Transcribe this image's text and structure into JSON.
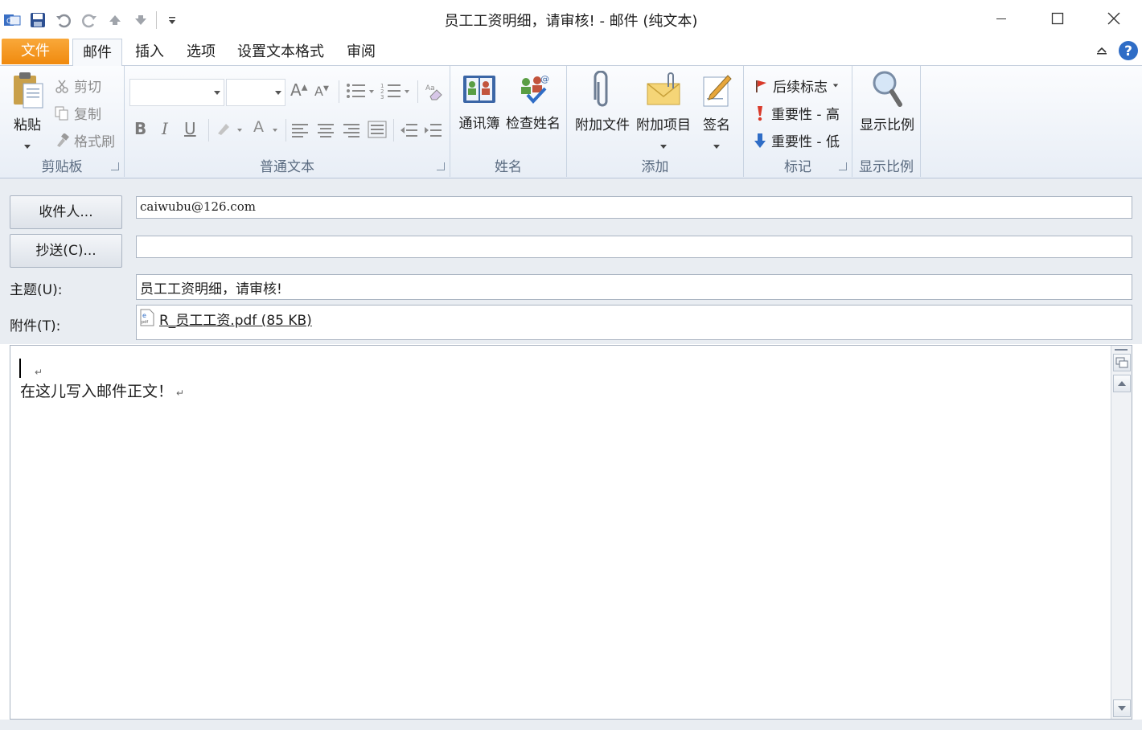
{
  "window": {
    "title": "员工工资明细，请审核!  - 邮件 (纯文本)"
  },
  "tabs": [
    {
      "label": "文件"
    },
    {
      "label": "邮件"
    },
    {
      "label": "插入"
    },
    {
      "label": "选项"
    },
    {
      "label": "设置文本格式"
    },
    {
      "label": "审阅"
    }
  ],
  "ribbon": {
    "clipboard": {
      "label": "剪贴板",
      "paste": "粘贴",
      "cut": "剪切",
      "copy": "复制",
      "format_painter": "格式刷"
    },
    "basic_text": {
      "label": "普通文本"
    },
    "names": {
      "label": "姓名",
      "address_book": "通讯簿",
      "check_names": "检查姓名"
    },
    "include": {
      "label": "添加",
      "attach_file": "附加文件",
      "attach_item": "附加项目",
      "signature": "签名"
    },
    "tags": {
      "label": "标记",
      "follow_up": "后续标志",
      "high_importance": "重要性 - 高",
      "low_importance": "重要性 - 低"
    },
    "zoom": {
      "label": "显示比例",
      "zoom": "显示比例"
    }
  },
  "header": {
    "to_button": "收件人...",
    "to_value": "caiwubu@126.com",
    "cc_button": "抄送(C)...",
    "cc_value": "",
    "subject_label": "主题(U):",
    "subject_value": "员工工资明细，请审核!",
    "attachment_label": "附件(T):",
    "attachment_name": "R_员工工资.pdf (85 KB)"
  },
  "body": {
    "line1": "",
    "line2": "在这儿写入邮件正文！"
  },
  "colors": {
    "file_tab": "#f39a1c",
    "ribbon_bg": "#eef2f8",
    "header_bg": "#e9edf2"
  }
}
